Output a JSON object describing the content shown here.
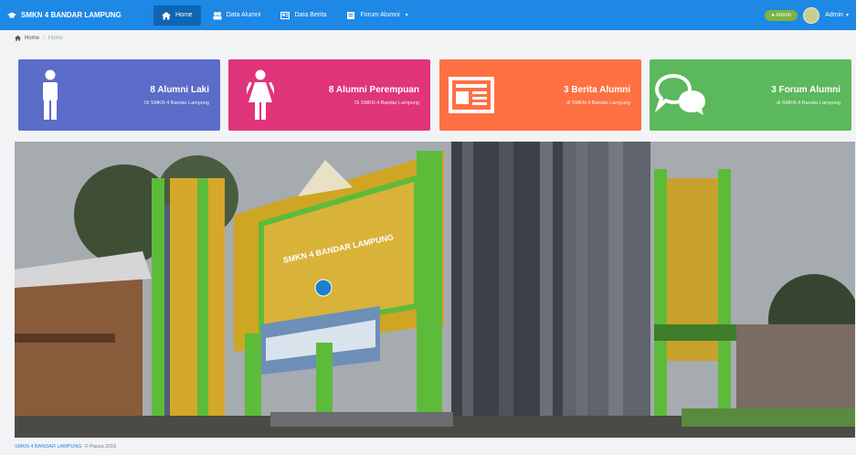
{
  "navbar": {
    "brand": "SMKN 4 BANDAR LAMPUNG",
    "items": [
      {
        "label": "Home",
        "icon": "home-icon",
        "active": true
      },
      {
        "label": "Data Alumni",
        "icon": "users-icon",
        "active": false
      },
      {
        "label": "Data Berita",
        "icon": "news-icon",
        "active": false
      },
      {
        "label": "Forum Alumni",
        "icon": "forum-icon",
        "active": false
      }
    ],
    "online_label": "● Admin",
    "user_name": "Admin"
  },
  "breadcrumb": {
    "home": "Home",
    "current": "Home"
  },
  "cards": [
    {
      "title": "8 Alumni Laki",
      "sub": "Di SMKN 4 Bandar Lampung",
      "color": "#5b6cc9",
      "icon": "male-icon"
    },
    {
      "title": "8 Alumni Perempuan",
      "sub": "Di SMKN 4 Bandar Lampung",
      "color": "#e0357a",
      "icon": "female-icon"
    },
    {
      "title": "3 Berita Alumni",
      "sub": "di SMKN 4 Bandar Lampung",
      "color": "#ff7043",
      "icon": "newspaper-icon"
    },
    {
      "title": "3 Forum Alumni",
      "sub": "di SMKN 4 Bandar Lampung",
      "color": "#5cb85c",
      "icon": "chat-bubbles-icon"
    }
  ],
  "hero": {
    "sign_text": "SMKN 4 BANDAR LAMPUNG"
  },
  "footer": {
    "link": "SMKN 4 BANDAR LAMPUNG",
    "text": "© Pasca 2016"
  }
}
